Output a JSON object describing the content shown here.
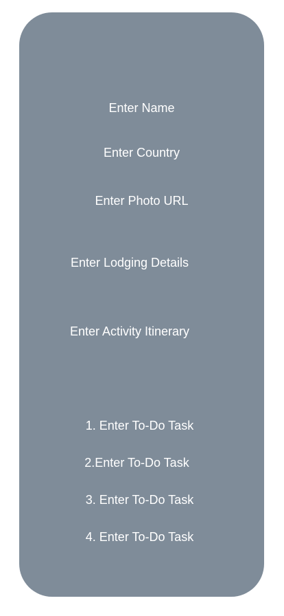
{
  "form": {
    "name_placeholder": "Enter Name",
    "country_placeholder": "Enter Country",
    "photo_url_placeholder": "Enter Photo URL",
    "lodging_placeholder": "Enter Lodging Details",
    "activity_placeholder": "Enter Activity Itinerary"
  },
  "todo": {
    "items": [
      "1. Enter To-Do Task",
      "2.Enter To-Do Task",
      "3. Enter To-Do Task",
      "4. Enter To-Do Task"
    ]
  },
  "colors": {
    "card_background": "#7f8c99",
    "text": "#ffffff"
  }
}
